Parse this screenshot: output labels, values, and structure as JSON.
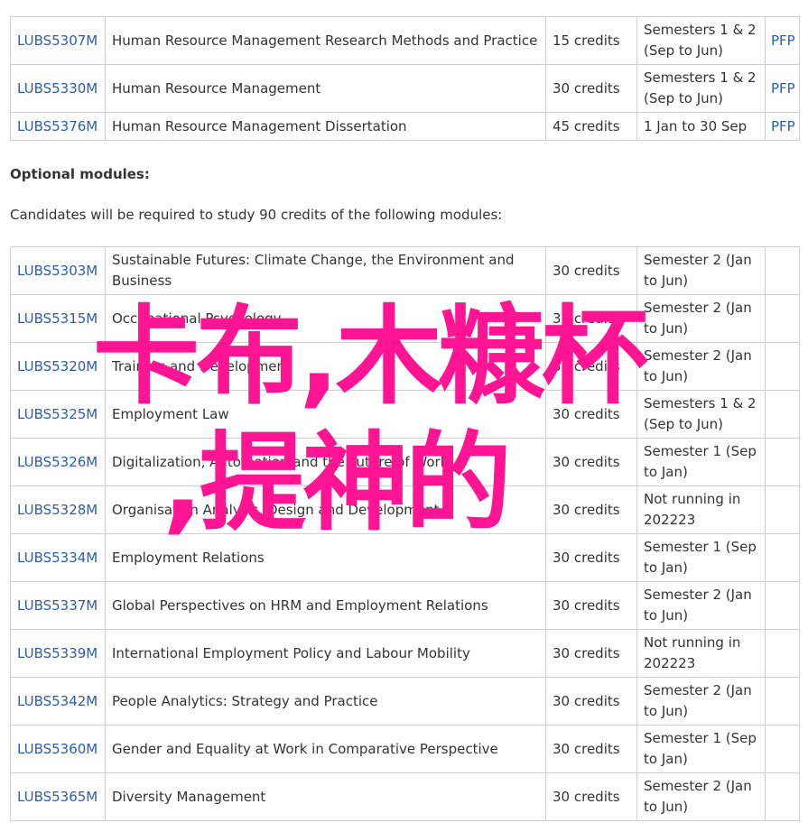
{
  "core_modules": [
    {
      "code": "LUBS5307M",
      "title": "Human Resource Management Research Methods and Practice",
      "credits": "15 credits",
      "semester": "Semesters 1 & 2 (Sep to Jun)",
      "pfp": "PFP"
    },
    {
      "code": "LUBS5330M",
      "title": "Human Resource Management",
      "credits": "30 credits",
      "semester": "Semesters 1 & 2 (Sep to Jun)",
      "pfp": "PFP"
    },
    {
      "code": "LUBS5376M",
      "title": "Human Resource Management Dissertation",
      "credits": "45 credits",
      "semester": "1 Jan to 30 Sep",
      "pfp": "PFP"
    }
  ],
  "optional": {
    "heading": "Optional modules:",
    "intro": "Candidates will be required to study 90 credits of the following modules:"
  },
  "optional_modules": [
    {
      "code": "LUBS5303M",
      "title": "Sustainable Futures: Climate Change, the Environment and Business",
      "credits": "30 credits",
      "semester": "Semester 2 (Jan to Jun)"
    },
    {
      "code": "LUBS5315M",
      "title": "Occupational Psychology",
      "credits": "30 credits",
      "semester": "Semester 2 (Jan to Jun)"
    },
    {
      "code": "LUBS5320M",
      "title": "Training and Development",
      "credits": "30 credits",
      "semester": "Semester 2 (Jan to Jun)"
    },
    {
      "code": "LUBS5325M",
      "title": "Employment Law",
      "credits": "30 credits",
      "semester": "Semesters 1 & 2 (Sep to Jun)"
    },
    {
      "code": "LUBS5326M",
      "title": "Digitalization, Automation and the Future of Work",
      "credits": "30 credits",
      "semester": "Semester 1 (Sep to Jan)"
    },
    {
      "code": "LUBS5328M",
      "title": "Organisation Analysis, Design and Development",
      "credits": "30 credits",
      "semester": "Not running in 202223"
    },
    {
      "code": "LUBS5334M",
      "title": "Employment Relations",
      "credits": "30 credits",
      "semester": "Semester 1 (Sep to Jan)"
    },
    {
      "code": "LUBS5337M",
      "title": "Global Perspectives on HRM and Employment Relations",
      "credits": "30 credits",
      "semester": "Semester 2 (Jan to Jun)"
    },
    {
      "code": "LUBS5339M",
      "title": "International Employment Policy and Labour Mobility",
      "credits": "30 credits",
      "semester": "Not running in 202223"
    },
    {
      "code": "LUBS5342M",
      "title": "People Analytics: Strategy and Practice",
      "credits": "30 credits",
      "semester": "Semester 2 (Jan to Jun)"
    },
    {
      "code": "LUBS5360M",
      "title": "Gender and Equality at Work in Comparative Perspective",
      "credits": "30 credits",
      "semester": "Semester 1 (Sep to Jan)"
    },
    {
      "code": "LUBS5365M",
      "title": "Diversity Management",
      "credits": "30 credits",
      "semester": "Semester 2 (Jan to Jun)"
    }
  ],
  "overlay": {
    "line1": "卡布,木糠杯",
    "line2": ",提神的",
    "color": "#ff1493"
  }
}
